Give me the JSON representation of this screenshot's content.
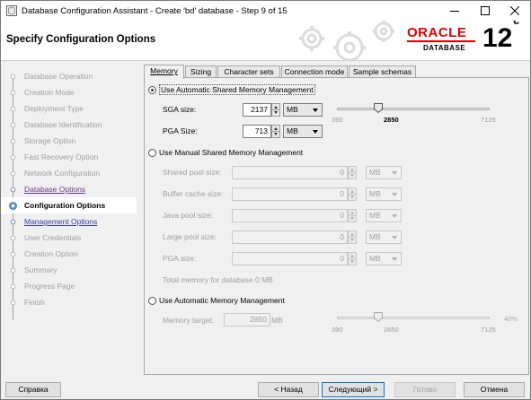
{
  "window": {
    "title": "Database Configuration Assistant - Create 'bd' database - Step 9 of 15"
  },
  "banner": {
    "heading": "Specify Configuration Options",
    "brand": "ORACLE",
    "brand_sub": "DATABASE",
    "version": "12",
    "version_sup": "c"
  },
  "nav": {
    "items": [
      {
        "label": "Database Operation",
        "state": "disabled"
      },
      {
        "label": "Creation Mode",
        "state": "disabled"
      },
      {
        "label": "Deployment Type",
        "state": "disabled"
      },
      {
        "label": "Database Identification",
        "state": "disabled"
      },
      {
        "label": "Storage Option",
        "state": "disabled"
      },
      {
        "label": "Fast Recovery Option",
        "state": "disabled"
      },
      {
        "label": "Network Configuration",
        "state": "disabled"
      },
      {
        "label": "Database Options",
        "state": "visited"
      },
      {
        "label": "Configuration Options",
        "state": "current"
      },
      {
        "label": "Management Options",
        "state": "link"
      },
      {
        "label": "User Credentials",
        "state": "disabled"
      },
      {
        "label": "Creation Option",
        "state": "disabled"
      },
      {
        "label": "Summary",
        "state": "disabled"
      },
      {
        "label": "Progress Page",
        "state": "disabled"
      },
      {
        "label": "Finish",
        "state": "disabled"
      }
    ]
  },
  "tabs": [
    {
      "label": "Memory",
      "active": true
    },
    {
      "label": "Sizing",
      "active": false
    },
    {
      "label": "Character sets",
      "active": false
    },
    {
      "label": "Connection mode",
      "active": false
    },
    {
      "label": "Sample schemas",
      "active": false
    }
  ],
  "memory": {
    "asmm": {
      "label": "Use Automatic Shared Memory Management",
      "selected": true,
      "sga_label": "SGA size:",
      "sga_value": "2137",
      "sga_unit": "MB",
      "pga_label": "PGA Size:",
      "pga_value": "713",
      "pga_unit": "MB",
      "slider": {
        "min": "390",
        "value": "2850",
        "max": "7125",
        "fraction": 0.27
      }
    },
    "manual": {
      "label": "Use Manual Shared Memory Management",
      "selected": false,
      "fields": [
        {
          "label": "Shared pool size:",
          "value": "0",
          "unit": "MB"
        },
        {
          "label": "Buffer cache size:",
          "value": "0",
          "unit": "MB"
        },
        {
          "label": "Java pool size:",
          "value": "0",
          "unit": "MB"
        },
        {
          "label": "Large pool size:",
          "value": "0",
          "unit": "MB"
        },
        {
          "label": "PGA size:",
          "value": "0",
          "unit": "MB"
        }
      ],
      "total": "Total memory for database 0 MB"
    },
    "amm": {
      "label": "Use Automatic Memory Management",
      "selected": false,
      "target_label": "Memory target:",
      "target_value": "2850",
      "target_unit": "MB",
      "percent": "40%",
      "slider": {
        "min": "390",
        "value": "2850",
        "max": "7125",
        "fraction": 0.27
      }
    }
  },
  "buttons": {
    "help": "Справка",
    "back": "< Назад",
    "next": "Следующий >",
    "finish": "Готово",
    "cancel": "Отмена"
  },
  "colors": {
    "oracle_red": "#e00000",
    "link": "#3838a8",
    "visited": "#6a3a8a",
    "focus_blue": "#0078d7"
  }
}
